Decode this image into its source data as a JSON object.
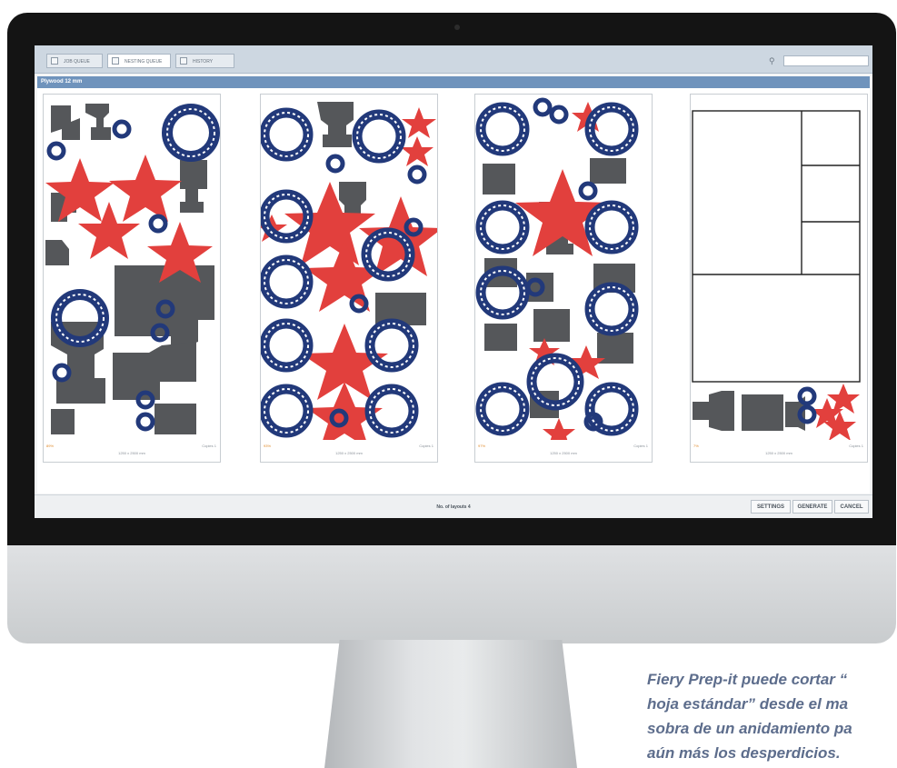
{
  "tabs": [
    {
      "label": "JOB QUEUE",
      "icon": "job-queue-icon"
    },
    {
      "label": "NESTING QUEUE",
      "icon": "nesting-queue-icon"
    },
    {
      "label": "HISTORY",
      "icon": "history-icon"
    }
  ],
  "search": {
    "placeholder": "",
    "icon": "search-icon"
  },
  "material_title": "Plywood 12 mm",
  "layouts": [
    {
      "efficiency": "89%",
      "dimensions": "1250 x 2500 mm",
      "copies": "Copies 1"
    },
    {
      "efficiency": "93%",
      "dimensions": "1250 x 2500 mm",
      "copies": "Copies 1"
    },
    {
      "efficiency": "97%",
      "dimensions": "1250 x 2500 mm",
      "copies": "Copies 1"
    },
    {
      "efficiency": "7%",
      "dimensions": "1250 x 2500 mm",
      "copies": "Copies 1"
    }
  ],
  "footer": {
    "layouts_count": "No. of layouts 4",
    "settings_label": "SETTINGS",
    "generate_label": "GENERATE",
    "cancel_label": "CANCEL"
  },
  "caption_lines": [
    "Fiery Prep-it puede cortar “",
    "hoja estándar” desde el ma",
    "sobra de un anidamiento pa",
    "aún más los desperdicios."
  ],
  "colors": {
    "medal_blue": "#22397a",
    "star_red": "#e2403d",
    "trophy_gray": "#55575a",
    "title_bar": "#6f93bc"
  }
}
